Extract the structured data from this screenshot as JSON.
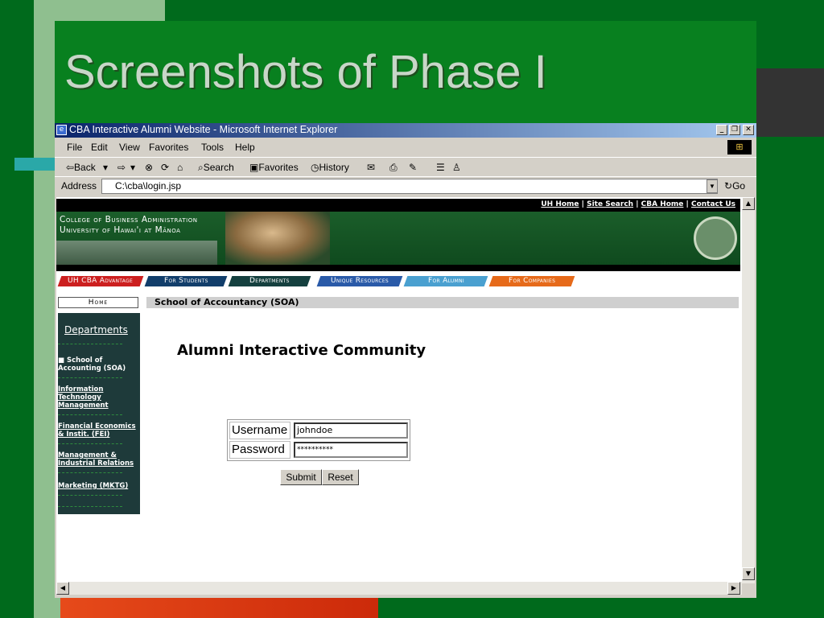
{
  "slide": {
    "title": "Screenshots of Phase I"
  },
  "window": {
    "title": "CBA Interactive Alumni Website - Microsoft Internet Explorer",
    "controls": [
      "_",
      "❐",
      "✕"
    ]
  },
  "menu": [
    "File",
    "Edit",
    "View",
    "Favorites",
    "Tools",
    "Help"
  ],
  "toolbar": {
    "back": "⇦Back",
    "back_arrow": "▾",
    "forward": "⇨",
    "forward_arrow": "▾",
    "stop": "⊗",
    "refresh": "⟳",
    "home": "⌂",
    "search": "Search",
    "favorites": "Favorites",
    "history": "History",
    "mail": "✉",
    "print": "⎙",
    "edit": "✎",
    "discuss": "☰",
    "messenger": "♙"
  },
  "address": {
    "label": "Address",
    "value": "C:\\cba\\login.jsp",
    "go": "Go"
  },
  "site": {
    "top_links": [
      "UH Home",
      "Site Search",
      "CBA Home",
      "Contact Us"
    ],
    "separator": "|",
    "banner_line1": "College of Business Administration",
    "banner_line2": "University of Hawai'i at Mānoa",
    "tabs": [
      {
        "label": "UH CBA Advantage",
        "color": "#cc1f1f"
      },
      {
        "label": "For Students",
        "color": "#123e6b"
      },
      {
        "label": "Departments",
        "color": "#15403f"
      },
      {
        "label": "Unique Resources",
        "color": "#2a5aa8"
      },
      {
        "label": "For Alumni",
        "color": "#4aa0d0"
      },
      {
        "label": "For Companies",
        "color": "#e66a1a"
      }
    ],
    "home_button": "Home",
    "section_title": "School of Accountancy (SOA)",
    "sidebar": {
      "heading": "Departments",
      "items": [
        "School of Accounting (SOA)",
        "Information Technology Management",
        "Financial Economics & Instit. (FEI)",
        "Management & Industrial Relations",
        "Marketing (MKTG)"
      ]
    },
    "page_heading": "Alumni Interactive Community",
    "login": {
      "username_label": "Username",
      "username_value": "johndoe",
      "password_label": "Password",
      "password_value": "**********",
      "submit": "Submit",
      "reset": "Reset"
    }
  }
}
